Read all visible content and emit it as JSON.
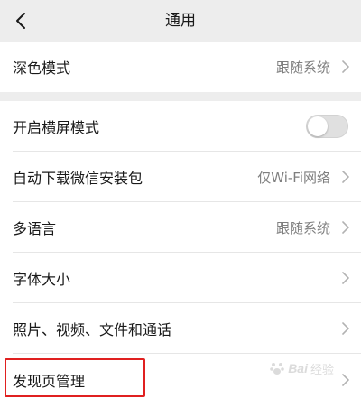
{
  "header": {
    "title": "通用",
    "back_icon": "chevron-left-icon"
  },
  "section_1": {
    "dark_mode": {
      "label": "深色模式",
      "value": "跟随系统"
    }
  },
  "section_2": {
    "landscape": {
      "label": "开启横屏模式",
      "toggle_on": false
    },
    "auto_download": {
      "label": "自动下载微信安装包",
      "value": "仅Wi-Fi网络"
    },
    "language": {
      "label": "多语言",
      "value": "跟随系统"
    },
    "font_size": {
      "label": "字体大小"
    },
    "media": {
      "label": "照片、视频、文件和通话"
    },
    "discover": {
      "label": "发现页管理"
    }
  },
  "watermark": {
    "brand": "Bai",
    "sub": "经验"
  },
  "colors": {
    "background": "#ededed",
    "surface": "#ffffff",
    "text_primary": "#191919",
    "text_secondary": "#7f7f7f",
    "highlight": "#e02020",
    "toggle_off": "#e0e0e0"
  }
}
